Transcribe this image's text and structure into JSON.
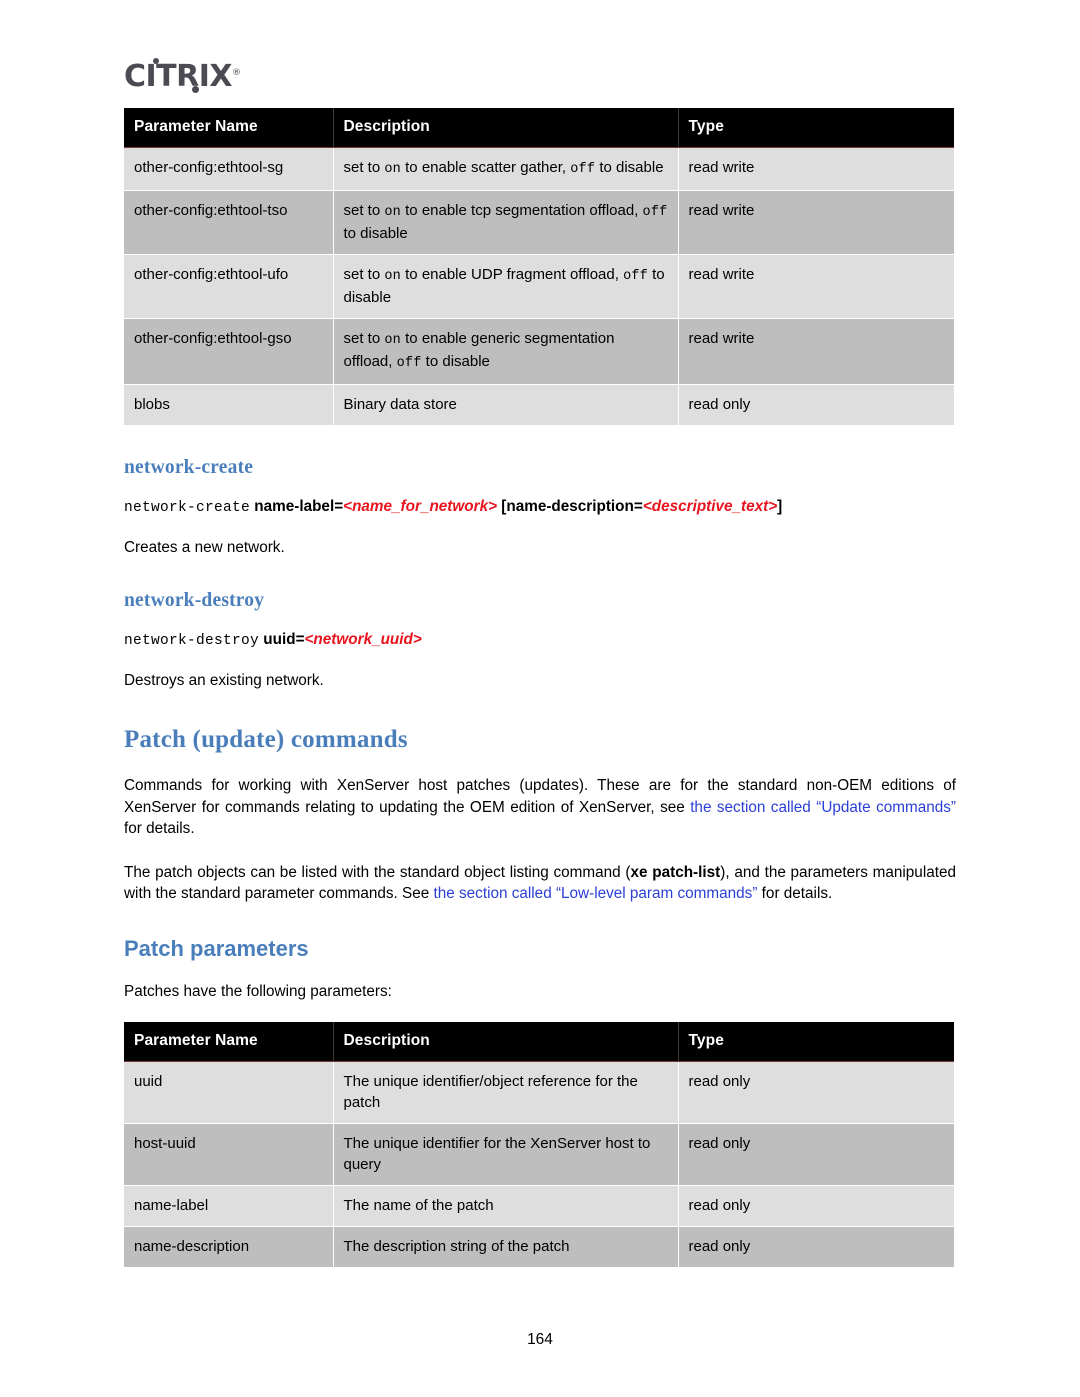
{
  "brand": {
    "logo_text": "CITRIX",
    "logo_registered": "®"
  },
  "tables": {
    "network_params": {
      "headers": [
        "Parameter Name",
        "Description",
        "Type"
      ],
      "rows": [
        {
          "name": "other-config:ethtool-sg",
          "desc_parts": [
            {
              "t": "set to ",
              "s": "plain"
            },
            {
              "t": "on",
              "s": "mono"
            },
            {
              "t": " to enable scatter gather, ",
              "s": "plain"
            },
            {
              "t": "off",
              "s": "mono"
            },
            {
              "t": " to disable",
              "s": "plain"
            }
          ],
          "type": "read write"
        },
        {
          "name": "other-config:ethtool-tso",
          "desc_parts": [
            {
              "t": "set to ",
              "s": "plain"
            },
            {
              "t": "on",
              "s": "mono"
            },
            {
              "t": " to enable tcp segmentation offload, ",
              "s": "plain"
            },
            {
              "t": "off",
              "s": "mono"
            },
            {
              "t": " to disable",
              "s": "plain"
            }
          ],
          "type": "read write"
        },
        {
          "name": "other-config:ethtool-ufo",
          "desc_parts": [
            {
              "t": "set to ",
              "s": "plain"
            },
            {
              "t": "on",
              "s": "mono"
            },
            {
              "t": " to enable UDP fragment offload, ",
              "s": "plain"
            },
            {
              "t": "off",
              "s": "mono"
            },
            {
              "t": " to disable",
              "s": "plain"
            }
          ],
          "type": "read write"
        },
        {
          "name": "other-config:ethtool-gso",
          "desc_parts": [
            {
              "t": "set to ",
              "s": "plain"
            },
            {
              "t": "on",
              "s": "mono"
            },
            {
              "t": " to enable generic segmentation offload, ",
              "s": "plain"
            },
            {
              "t": "off",
              "s": "mono"
            },
            {
              "t": " to disable",
              "s": "plain"
            }
          ],
          "type": "read write"
        },
        {
          "name": "blobs",
          "desc_parts": [
            {
              "t": "Binary data store",
              "s": "plain"
            }
          ],
          "type": "read only"
        }
      ]
    },
    "patch_params": {
      "headers": [
        "Parameter Name",
        "Description",
        "Type"
      ],
      "rows": [
        {
          "name": "uuid",
          "desc_parts": [
            {
              "t": "The unique identifier/object reference for the patch",
              "s": "plain"
            }
          ],
          "type": "read only"
        },
        {
          "name": "host-uuid",
          "desc_parts": [
            {
              "t": "The unique identifier for the XenServer host to query",
              "s": "plain"
            }
          ],
          "type": "read only"
        },
        {
          "name": "name-label",
          "desc_parts": [
            {
              "t": "The name of the patch",
              "s": "plain"
            }
          ],
          "type": "read only"
        },
        {
          "name": "name-description",
          "desc_parts": [
            {
              "t": "The description string of the patch",
              "s": "plain"
            }
          ],
          "type": "read only"
        }
      ]
    }
  },
  "sections": {
    "network_create": {
      "heading": "network-create",
      "syntax": {
        "command": "network-create",
        "arg1_label": "name-label=",
        "arg1_placeholder": "<name_for_network>",
        "arg2_open": "[name-description=",
        "arg2_placeholder": "<descriptive_text>",
        "arg2_close": "]"
      },
      "description": "Creates a new network."
    },
    "network_destroy": {
      "heading": "network-destroy",
      "syntax": {
        "command": "network-destroy",
        "arg1_label": "uuid=",
        "arg1_placeholder": "<network_uuid>"
      },
      "description": "Destroys an existing network."
    },
    "patch_commands": {
      "heading": "Patch (update) commands",
      "paragraph1": {
        "part1": "Commands for working with XenServer host patches (updates). These are for the standard non-OEM editions of XenServer for commands relating to updating the OEM edition of XenServer, see ",
        "link": "the section called “Update commands”",
        "part2": " for details."
      },
      "paragraph2": {
        "part1": "The patch objects can be listed with the standard object listing command (",
        "bold": "xe patch-list",
        "part2": "), and the parameters manipulated with the standard parameter commands. See ",
        "link": "the section called “Low-level param commands”",
        "part3": " for details."
      }
    },
    "patch_parameters": {
      "heading": "Patch parameters",
      "intro": "Patches have the following parameters:"
    }
  },
  "footer": {
    "page_number": "164"
  },
  "colors": {
    "heading_blue": "#4a7ebb",
    "link_blue": "#2b3fd6",
    "placeholder_red": "#e8141e",
    "table_header_bg": "#000000",
    "row_odd": "#dededf",
    "row_even": "#bebebf",
    "logo_gray": "#4b4b53"
  }
}
